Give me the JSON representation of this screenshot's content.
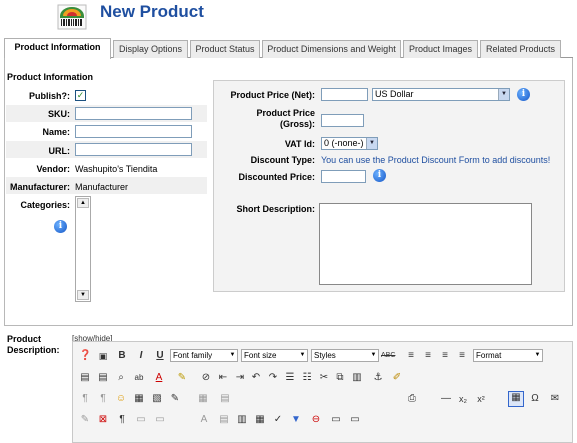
{
  "header": {
    "title": "New Product",
    "logo_icon": "barcode-box-icon"
  },
  "tabs": [
    {
      "label": "Product Information",
      "active": true
    },
    {
      "label": "Display Options"
    },
    {
      "label": "Product Status"
    },
    {
      "label": "Product Dimensions and Weight"
    },
    {
      "label": "Product Images"
    },
    {
      "label": "Related Products"
    }
  ],
  "info": {
    "section_title": "Product Information",
    "publish_label": "Publish?:",
    "publish_checked": true,
    "sku_label": "SKU:",
    "sku_value": "",
    "name_label": "Name:",
    "name_value": "",
    "url_label": "URL:",
    "url_value": "",
    "vendor_label": "Vendor:",
    "vendor_value": "Washupito's Tiendita",
    "manufacturer_label": "Manufacturer:",
    "manufacturer_value": "Manufacturer",
    "categories_label": "Categories:"
  },
  "price": {
    "net_label": "Product Price (Net):",
    "net_value": "",
    "currency": "US Dollar",
    "gross_label_1": "Product Price",
    "gross_label_2": "(Gross):",
    "gross_value": "",
    "vat_label": "VAT Id:",
    "vat_value": "0 (-none-)",
    "discount_type_label": "Discount Type:",
    "discount_type_text": "You can use the Product Discount Form to add discounts!",
    "discounted_label": "Discounted Price:",
    "discounted_value": "",
    "short_desc_label": "Short Description:"
  },
  "description": {
    "label_1": "Product",
    "label_2": "Description:",
    "toggle": "[show/hide]",
    "font_family": "Font family",
    "font_size": "Font size",
    "styles": "Styles",
    "format": "Format"
  }
}
